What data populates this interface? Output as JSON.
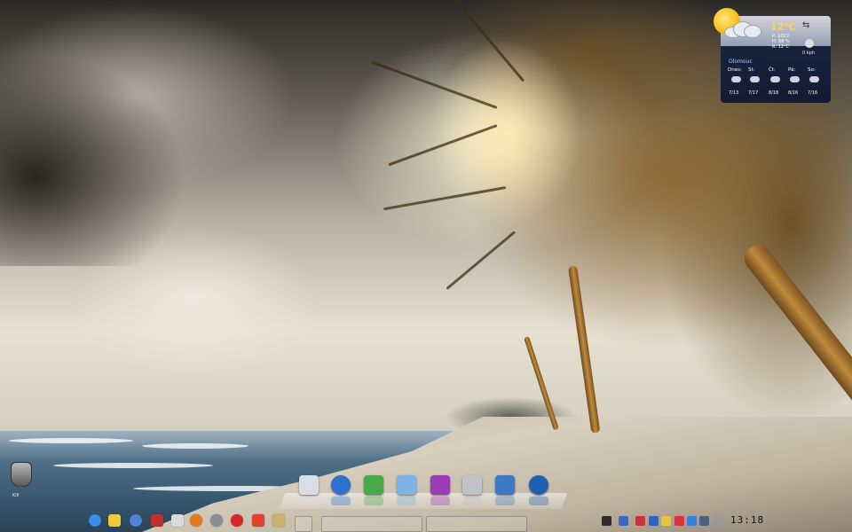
{
  "weather": {
    "temperature": "12°C",
    "details": [
      "P: 1022",
      "H: 88 %",
      "R: 12°C"
    ],
    "wind_speed": "0 kph",
    "city": "Olomouc",
    "forecast": [
      {
        "day": "Dnes:",
        "temp": "7/13"
      },
      {
        "day": "St:",
        "temp": "7/17"
      },
      {
        "day": "Čt:",
        "temp": "8/18"
      },
      {
        "day": "Pá:",
        "temp": "8/16"
      },
      {
        "day": "So:",
        "temp": "7/16"
      }
    ]
  },
  "mic_widget": {
    "label": "Kill"
  },
  "dock": {
    "icons": [
      {
        "name": "mail-icon",
        "color": "#d9dee6"
      },
      {
        "name": "globe-icon",
        "color": "#2f6fd0"
      },
      {
        "name": "file-manager-icon",
        "color": "#49a84a"
      },
      {
        "name": "home-folder-icon",
        "color": "#7fb2e6"
      },
      {
        "name": "media-player-icon",
        "color": "#9b3bb5"
      },
      {
        "name": "calculator-icon",
        "color": "#bfc3c8"
      },
      {
        "name": "presentation-icon",
        "color": "#3d7ac4"
      },
      {
        "name": "browser-icon",
        "color": "#1f5fb0"
      }
    ]
  },
  "panel": {
    "launchers": [
      {
        "name": "start-menu-icon",
        "color": "#3a8ee6"
      },
      {
        "name": "chat-icon",
        "color": "#f0c93a"
      },
      {
        "name": "settings-icon",
        "color": "#4f83d4"
      },
      {
        "name": "video-icon",
        "color": "#c03030"
      },
      {
        "name": "editor-icon",
        "color": "#dadada"
      },
      {
        "name": "firefox-icon",
        "color": "#e27a1f"
      },
      {
        "name": "disk-icon",
        "color": "#8a8f96"
      },
      {
        "name": "music-icon",
        "color": "#d8262a"
      },
      {
        "name": "graphics-icon",
        "color": "#e0442f"
      },
      {
        "name": "notes-icon",
        "color": "#c9b16a"
      }
    ],
    "tray": [
      {
        "name": "terminal-icon",
        "color": "#2b2b2b"
      },
      {
        "name": "network-icon",
        "color": "#3b66c4"
      },
      {
        "name": "flag-icon",
        "color": "#c73636"
      },
      {
        "name": "mail-tray-icon",
        "color": "#2c63c9"
      },
      {
        "name": "folder-tray-icon",
        "color": "#e8c63b"
      },
      {
        "name": "update-icon",
        "color": "#d9343a"
      },
      {
        "name": "bluetooth-icon",
        "color": "#3b7ee0"
      },
      {
        "name": "volume-icon",
        "color": "#506080"
      },
      {
        "name": "power-icon",
        "color": "#999999"
      }
    ],
    "clock": "13:18"
  }
}
